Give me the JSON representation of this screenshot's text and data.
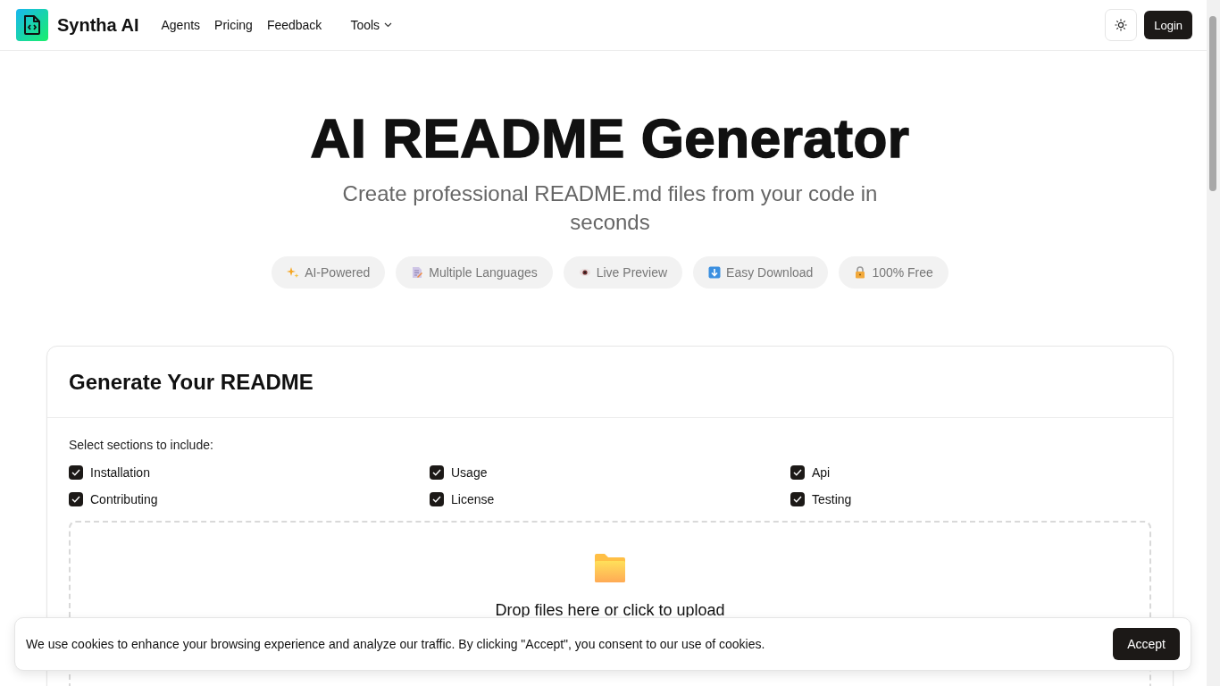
{
  "header": {
    "brand": "Syntha AI",
    "nav": [
      {
        "label": "Agents",
        "kind": "link"
      },
      {
        "label": "Pricing",
        "kind": "link"
      },
      {
        "label": "Feedback",
        "kind": "link"
      },
      {
        "label": "Tools",
        "kind": "dropdown"
      }
    ],
    "login": "Login"
  },
  "hero": {
    "title": "AI README Generator",
    "subtitle": "Create professional README.md files from your code in seconds",
    "badges": [
      {
        "label": "AI-Powered"
      },
      {
        "label": "Multiple Languages"
      },
      {
        "label": "Live Preview"
      },
      {
        "label": "Easy Download"
      },
      {
        "label": "100% Free"
      }
    ]
  },
  "card": {
    "title": "Generate Your README",
    "sections_label": "Select sections to include:",
    "sections": [
      {
        "label": "Installation",
        "checked": true
      },
      {
        "label": "Usage",
        "checked": true
      },
      {
        "label": "Api",
        "checked": true
      },
      {
        "label": "Contributing",
        "checked": true
      },
      {
        "label": "License",
        "checked": true
      },
      {
        "label": "Testing",
        "checked": true
      }
    ],
    "dropzone": {
      "text": "Drop files here or click to upload"
    }
  },
  "cookie_banner": {
    "text": "We use cookies to enhance your browsing experience and analyze our traffic. By clicking \"Accept\", you consent to our use of cookies.",
    "button": "Accept"
  }
}
